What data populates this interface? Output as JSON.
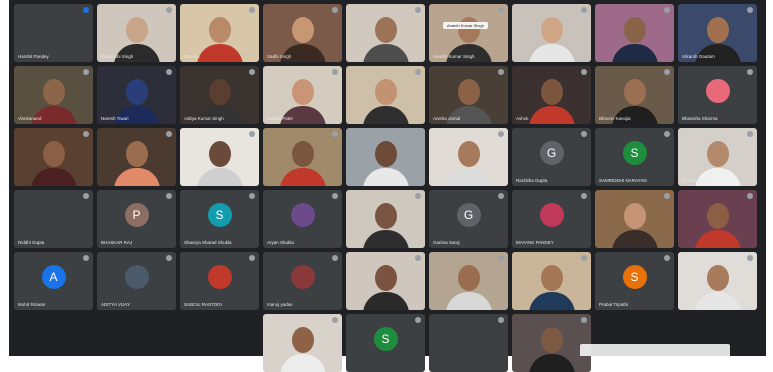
{
  "colors": {
    "frame_bg": "#202124",
    "tile_bg": "#3c4043",
    "name_text": "#e8eaed"
  },
  "participants": [
    {
      "name": "Harshit Pandey",
      "kind": "avatar",
      "avatar_letter": "",
      "avatar_color": "#3c4043",
      "mic": "blue"
    },
    {
      "name": "Divyanshi Singh",
      "kind": "video",
      "skin": "#c9a58a",
      "shirt": "#2b2b2b",
      "bg": "#cfc6bc"
    },
    {
      "name": "TULIKA",
      "kind": "video",
      "skin": "#b98968",
      "shirt": "#c0392b",
      "bg": "#d8c6a8"
    },
    {
      "name": "Sadhi Singh",
      "kind": "video",
      "skin": "#c79673",
      "shirt": "#3b2a22",
      "bg": "#7b5a4a"
    },
    {
      "name": "",
      "kind": "video",
      "skin": "#9c7356",
      "shirt": "#4d4d4d",
      "bg": "#d2c9be"
    },
    {
      "name": "Ananth Kumar Singh",
      "kind": "video",
      "skin": "#a57a5a",
      "shirt": "#2e2e2e",
      "bg": "#b9a48f",
      "chip": "Ananth Kumar Singh"
    },
    {
      "name": "",
      "kind": "video",
      "skin": "#d0a585",
      "shirt": "#e6e6e6",
      "bg": "#c8c2ba"
    },
    {
      "name": "",
      "kind": "video",
      "skin": "#8a6448",
      "shirt": "#1f2a44",
      "bg": "#9d6a8a"
    },
    {
      "name": "Utkarsh Gautam",
      "kind": "video",
      "skin": "#a07050",
      "shirt": "#222",
      "bg": "#3b4a6b"
    },
    {
      "name": "Vivekanand",
      "kind": "video",
      "skin": "#8d6549",
      "shirt": "#7a2a2a",
      "bg": "#5a5040"
    },
    {
      "name": "Naresh Tiwari",
      "kind": "video",
      "skin": "#2a3f7a",
      "shirt": "#1b2a5a",
      "bg": "#2c2f3a"
    },
    {
      "name": "Aditya Kumar Singh",
      "kind": "video",
      "skin": "#5a3e30",
      "shirt": "#333",
      "bg": "#3a3330"
    },
    {
      "name": "Suhani Patel",
      "kind": "video",
      "skin": "#c99576",
      "shirt": "#5a3a40",
      "bg": "#d5ccc0"
    },
    {
      "name": "",
      "kind": "video",
      "skin": "#c29272",
      "shirt": "#2f2f2f",
      "bg": "#cdbfa8"
    },
    {
      "name": "Anisha Jamal",
      "kind": "video",
      "skin": "#8c6246",
      "shirt": "#555",
      "bg": "#4a3f36"
    },
    {
      "name": "Ashok",
      "kind": "video",
      "skin": "#7d5640",
      "shirt": "#c0392b",
      "bg": "#3a3030"
    },
    {
      "name": "Bhoomi Kanojia",
      "kind": "video",
      "skin": "#9b6f52",
      "shirt": "#1f1f1f",
      "bg": "#6a5a4a"
    },
    {
      "name": "Bhavisha Sharma",
      "kind": "avatar",
      "avatar_letter": "",
      "avatar_color": "#e86a7a",
      "mic": "gray"
    },
    {
      "name": "",
      "kind": "video",
      "skin": "#8a5f45",
      "shirt": "#4a2020",
      "bg": "#5a4030"
    },
    {
      "name": "",
      "kind": "video",
      "skin": "#9a6c4e",
      "shirt": "#e08a6a",
      "bg": "#4a3a30"
    },
    {
      "name": "",
      "kind": "video",
      "skin": "#6a4a38",
      "shirt": "#cfcfcf",
      "bg": "#e8e4de"
    },
    {
      "name": "",
      "kind": "video",
      "skin": "#7a5540",
      "shirt": "#c0392b",
      "bg": "#a08a6a"
    },
    {
      "name": "",
      "kind": "video",
      "skin": "#6d4b38",
      "shirt": "#e8e8e8",
      "bg": "#9aa2a8"
    },
    {
      "name": "",
      "kind": "video",
      "skin": "#a67b5d",
      "shirt": "#dcdcdc",
      "bg": "#e0dbd4"
    },
    {
      "name": "Rachitha Gupta",
      "kind": "avatar",
      "avatar_letter": "G",
      "avatar_color": "#5f6368",
      "mic": "gray"
    },
    {
      "name": "SAMRIDDHI NARAYAN",
      "kind": "avatar",
      "avatar_letter": "S",
      "avatar_color": "#1e8e3e",
      "mic": "gray"
    },
    {
      "name": "YASHASVI DIXIT",
      "kind": "video",
      "skin": "#b48a6c",
      "shirt": "#f0f0f0",
      "bg": "#d4cfc8"
    },
    {
      "name": "Riddhi Gupta",
      "kind": "avatar",
      "avatar_letter": "",
      "avatar_color": "#3c4043",
      "mic": "gray"
    },
    {
      "name": "BHASKAR RAJ",
      "kind": "avatar",
      "avatar_letter": "P",
      "avatar_color": "#8d6e63",
      "mic": "gray"
    },
    {
      "name": "Shaurya Sharad Shukla",
      "kind": "avatar",
      "avatar_letter": "S",
      "avatar_color": "#129eaf",
      "mic": "gray"
    },
    {
      "name": "Aryan Shukla",
      "kind": "avatar",
      "avatar_letter": "",
      "avatar_color": "#6a4a8a",
      "mic": "gray"
    },
    {
      "name": "",
      "kind": "video",
      "skin": "#7a5642",
      "shirt": "#2e2e2e",
      "bg": "#cfc8bf"
    },
    {
      "name": "Garima Saroj",
      "kind": "avatar",
      "avatar_letter": "G",
      "avatar_color": "#5f6368",
      "mic": "gray"
    },
    {
      "name": "MAYANK PANDEY",
      "kind": "avatar",
      "avatar_letter": "",
      "avatar_color": "#c0395b",
      "mic": "gray"
    },
    {
      "name": "",
      "kind": "video",
      "skin": "#c49474",
      "shirt": "#3a2e2a",
      "bg": "#8a6a4a"
    },
    {
      "name": "",
      "kind": "video",
      "skin": "#8c5e46",
      "shirt": "#c0392b",
      "bg": "#6a4050"
    },
    {
      "name": "Mohd Rizwan",
      "kind": "avatar",
      "avatar_letter": "A",
      "avatar_color": "#1a73e8",
      "mic": "gray"
    },
    {
      "name": "ADITYA VIJAY",
      "kind": "avatar",
      "avatar_letter": "",
      "avatar_color": "#4a5a6a",
      "mic": "gray"
    },
    {
      "name": "SUBOLI RASTOGI",
      "kind": "avatar",
      "avatar_letter": "",
      "avatar_color": "#c0392b",
      "mic": "gray"
    },
    {
      "name": "manoj yadav",
      "kind": "avatar",
      "avatar_letter": "",
      "avatar_color": "#8a3a3a",
      "mic": "gray"
    },
    {
      "name": "",
      "kind": "video",
      "skin": "#7a5440",
      "shirt": "#2a2a2a",
      "bg": "#cfc7bd"
    },
    {
      "name": "",
      "kind": "video",
      "skin": "#9a6c50",
      "shirt": "#d8d8d8",
      "bg": "#b3a591"
    },
    {
      "name": "",
      "kind": "video",
      "skin": "#a37656",
      "shirt": "#1f3a5a",
      "bg": "#c9b69a"
    },
    {
      "name": "Prabal Tripathi",
      "kind": "avatar",
      "avatar_letter": "S",
      "avatar_color": "#e8710a",
      "mic": "gray"
    },
    {
      "name": "",
      "kind": "video",
      "skin": "#a77a5c",
      "shirt": "#e6e6e6",
      "bg": "#e0ddd8"
    },
    {
      "name": "",
      "kind": "empty",
      "mic": "none"
    },
    {
      "name": "",
      "kind": "video",
      "skin": "#8d6246",
      "shirt": "#ececec",
      "bg": "#d8d2ca"
    },
    {
      "name": "",
      "kind": "avatar",
      "avatar_letter": "S",
      "avatar_color": "#1e8e3e",
      "mic": "gray"
    },
    {
      "name": "",
      "kind": "avatar",
      "avatar_letter": "",
      "avatar_color": "#3c4043",
      "mic": "gray"
    },
    {
      "name": "",
      "kind": "video",
      "skin": "#7d5a44",
      "shirt": "#1f1f1f",
      "bg": "#5a5050"
    },
    {
      "name": "",
      "kind": "empty",
      "mic": "none"
    }
  ]
}
